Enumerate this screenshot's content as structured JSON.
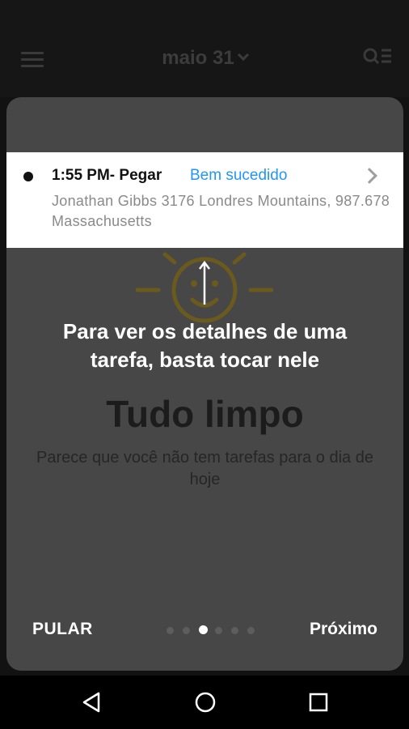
{
  "header": {
    "title": "maio 31"
  },
  "task": {
    "time_type": "1:55 PM- Pegar",
    "status": "Bem sucedido",
    "status_color": "#2196f3",
    "address": "Jonathan Gibbs 3176 Londres Mountains, 987.678 Massachusetts"
  },
  "tutorial": {
    "tip": "Para ver os detalhes de uma tarefa, basta tocar nele",
    "skip_label": "PULAR",
    "next_label": "Próximo",
    "page_count": 6,
    "current_page": 3
  },
  "empty_state": {
    "title": "Tudo limpo",
    "subtitle": "Parece que você não tem tarefas para o dia de hoje"
  },
  "icons": {
    "menu": "menu-icon",
    "search_list": "search-list-icon",
    "sun": "sun-icon",
    "back": "back-icon",
    "home": "home-icon",
    "recent": "recent-apps-icon"
  }
}
